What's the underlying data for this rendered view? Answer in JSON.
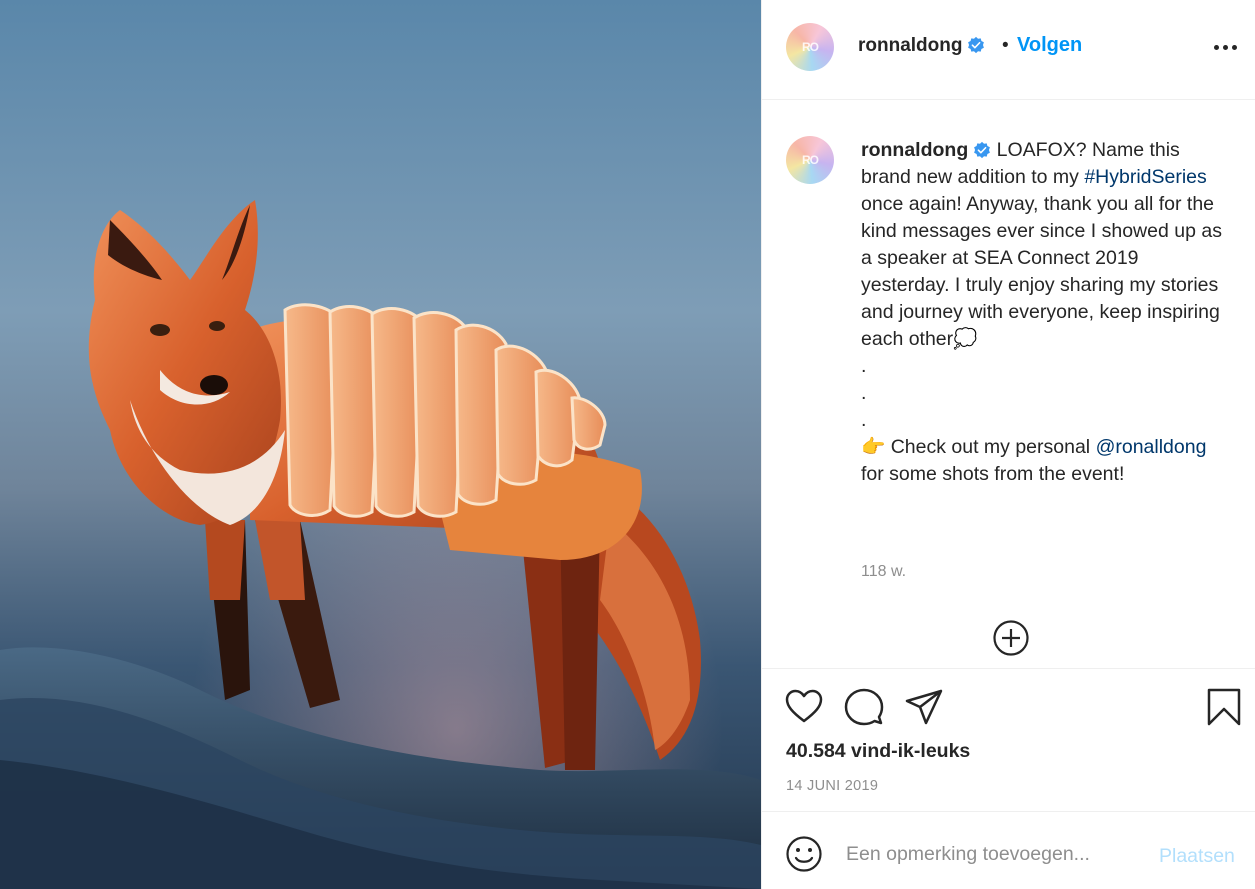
{
  "post": {
    "image_alt": "Fox with a bread loaf body",
    "avatar_initials": "RO"
  },
  "header": {
    "username": "ronnaldong",
    "dot": "•",
    "follow_label": "Volgen",
    "more_icon": "more-options-icon"
  },
  "caption": {
    "username": "ronnaldong",
    "line_1": "LOAFOX? Name this brand new addition to my",
    "hashtag": "#HybridSeries",
    "line_2": "once again! Anyway, thank you all for the kind messages ever since I showed up as a speaker at SEA Connect 2019 yesterday. I truly enjoy sharing my stories and journey with everyone, keep inspiring each other",
    "speech_emoji": "💭",
    "dots": [
      ".",
      ".",
      "."
    ],
    "pointing_emoji": "👉",
    "line_3": "Check out my personal",
    "mention": "@ronalldong",
    "line_4": "for some shots from the event!"
  },
  "time_ago": "118 w.",
  "actions": {
    "like_icon": "heart-icon",
    "comment_icon": "comment-icon",
    "share_icon": "share-icon",
    "save_icon": "bookmark-icon"
  },
  "likes": "40.584 vind-ik-leuks",
  "date": "14 JUNI 2019",
  "composer": {
    "placeholder": "Een opmerking toevoegen...",
    "post_label": "Plaatsen"
  },
  "colors": {
    "link": "#0095f6",
    "hashtag": "#00376b",
    "muted": "#8e8e8e",
    "disabled_post": "#b2dffc",
    "verified": "#3897f0"
  }
}
